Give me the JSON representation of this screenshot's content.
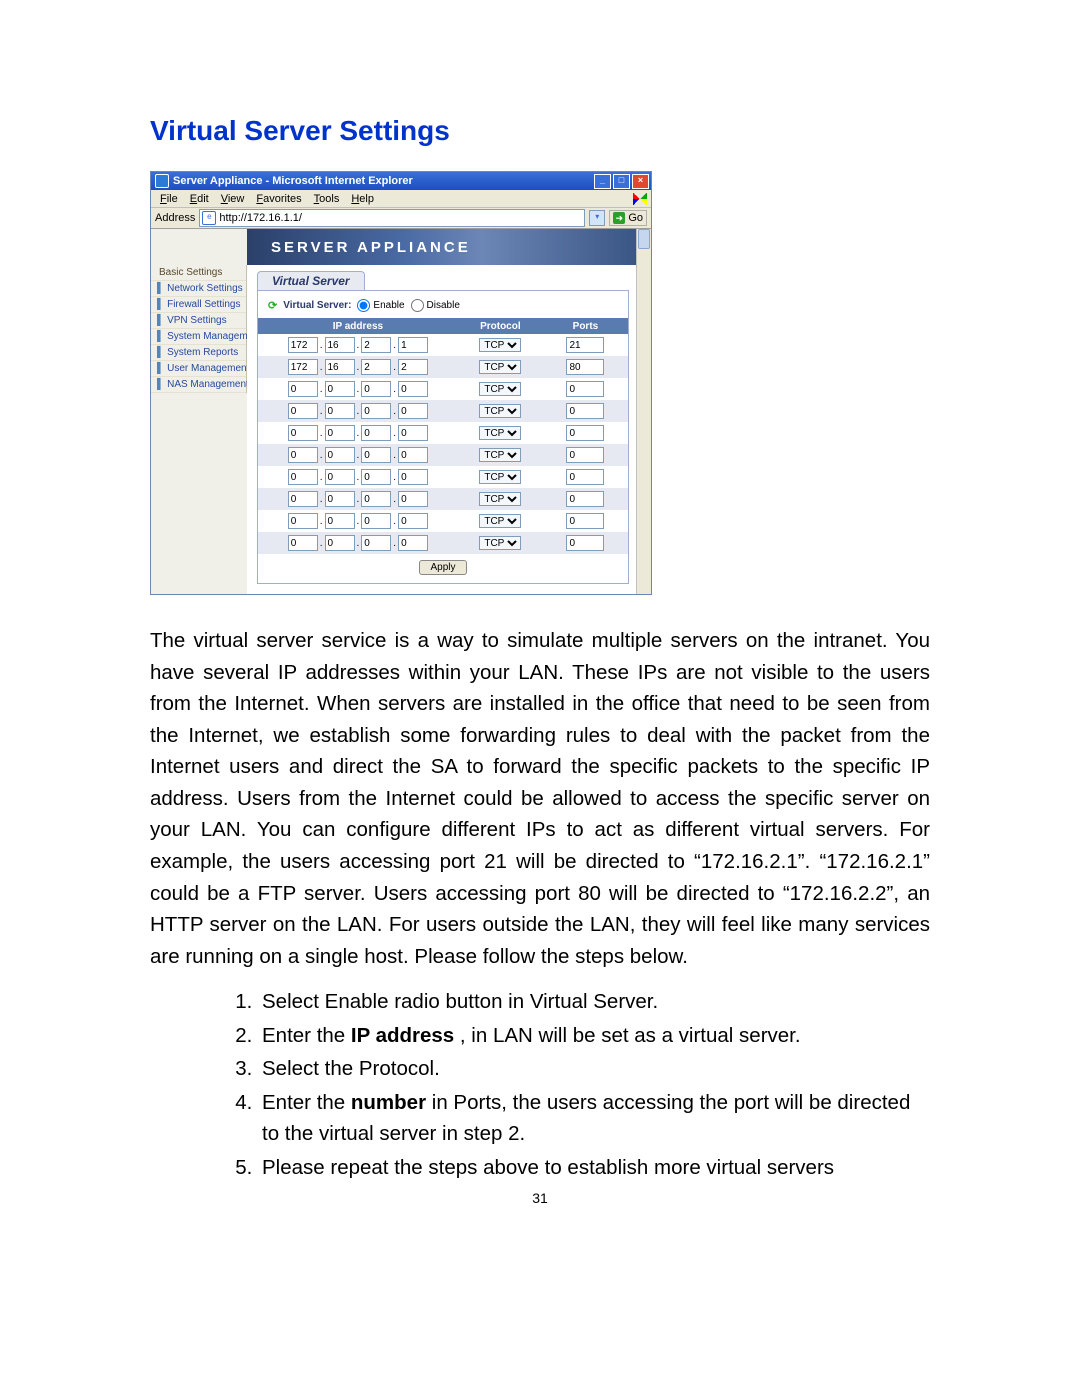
{
  "title": "Virtual Server Settings",
  "browser": {
    "window_title": "Server Appliance - Microsoft Internet Explorer",
    "menus": [
      "File",
      "Edit",
      "View",
      "Favorites",
      "Tools",
      "Help"
    ],
    "address_label": "Address",
    "address_value": "http://172.16.1.1/",
    "go_label": "Go",
    "banner": "SERVER APPLIANCE"
  },
  "sidebar": {
    "items": [
      {
        "label": "Basic Settings",
        "plain": true
      },
      {
        "label": "Network Settings"
      },
      {
        "label": "Firewall Settings"
      },
      {
        "label": "VPN Settings"
      },
      {
        "label": "System Management"
      },
      {
        "label": "System Reports"
      },
      {
        "label": "User Management"
      },
      {
        "label": "NAS Management"
      }
    ]
  },
  "panel": {
    "tab_label": "Virtual Server",
    "enable_label": "Virtual Server:",
    "opt_enable": "Enable",
    "opt_disable": "Disable",
    "headers": {
      "ip": "IP address",
      "protocol": "Protocol",
      "ports": "Ports"
    },
    "rows": [
      {
        "ip": [
          "172",
          "16",
          "2",
          "1"
        ],
        "proto": "TCP",
        "port": "21"
      },
      {
        "ip": [
          "172",
          "16",
          "2",
          "2"
        ],
        "proto": "TCP",
        "port": "80"
      },
      {
        "ip": [
          "0",
          "0",
          "0",
          "0"
        ],
        "proto": "TCP",
        "port": "0"
      },
      {
        "ip": [
          "0",
          "0",
          "0",
          "0"
        ],
        "proto": "TCP",
        "port": "0"
      },
      {
        "ip": [
          "0",
          "0",
          "0",
          "0"
        ],
        "proto": "TCP",
        "port": "0"
      },
      {
        "ip": [
          "0",
          "0",
          "0",
          "0"
        ],
        "proto": "TCP",
        "port": "0"
      },
      {
        "ip": [
          "0",
          "0",
          "0",
          "0"
        ],
        "proto": "TCP",
        "port": "0"
      },
      {
        "ip": [
          "0",
          "0",
          "0",
          "0"
        ],
        "proto": "TCP",
        "port": "0"
      },
      {
        "ip": [
          "0",
          "0",
          "0",
          "0"
        ],
        "proto": "TCP",
        "port": "0"
      },
      {
        "ip": [
          "0",
          "0",
          "0",
          "0"
        ],
        "proto": "TCP",
        "port": "0"
      }
    ],
    "apply_label": "Apply"
  },
  "body_paragraph": "The virtual server service is a way to simulate multiple servers on the intranet. You have several IP addresses within your LAN. These IPs are not visible to the users from the Internet. When servers are installed in the office that need to be seen from the Internet, we establish some forwarding rules to deal with the packet from the Internet users and direct the SA to forward the specific packets to the specific IP address. Users from the Internet could be allowed to access the specific server on your LAN. You can configure different IPs to act as different virtual servers. For example, the users accessing port 21 will be directed to “172.16.2.1”. “172.16.2.1” could be a FTP server. Users accessing port 80 will be directed to “172.16.2.2”, an HTTP server on the LAN. For users outside the LAN, they will feel like many services are running on a single host. Please follow the steps below.",
  "steps": {
    "s1": "Select Enable radio button in Virtual Server.",
    "s2a": "Enter the ",
    "s2b": "IP address",
    "s2c": " , in LAN will be set as a virtual server.",
    "s3": "Select the Protocol.",
    "s4a": "Enter the ",
    "s4b": "number",
    "s4c": " in Ports, the users accessing the port will be directed to the virtual server in step 2.",
    "s5": "Please repeat the steps above to establish more virtual servers"
  },
  "page_number": "31"
}
